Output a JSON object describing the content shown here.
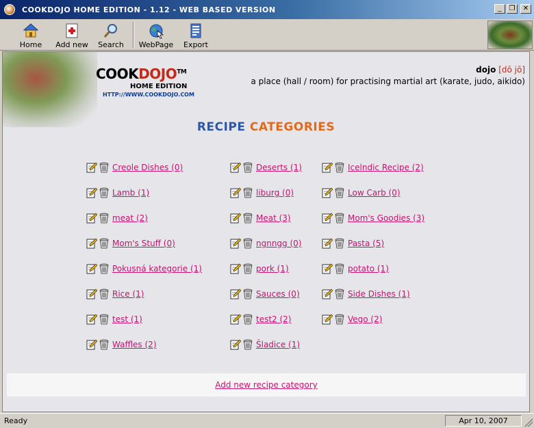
{
  "window": {
    "title": "COOKDOJO HOME EDITION - 1.12 - WEB BASED VERSION",
    "buttons": {
      "minimize": "_",
      "restore": "❐",
      "close": "✕"
    }
  },
  "toolbar": {
    "home": "Home",
    "add_new": "Add new",
    "search": "Search",
    "webpage": "WebPage",
    "export": "Export"
  },
  "header": {
    "brand_cook": "COOK",
    "brand_dojo": "DOJO",
    "brand_tm": "TM",
    "edition": "HOME EDITION",
    "url": "HTTP://WWW.COOKDOJO.COM",
    "definition_word": "dojo",
    "definition_pron": "[dō jō]",
    "definition_text": "a place (hall / room) for practising martial art (karate, judo, aikido)"
  },
  "section": {
    "title_1": "RECIPE",
    "title_2": "CATEGORIES"
  },
  "categories": [
    {
      "label": "Creole Dishes (0)"
    },
    {
      "label": "Lamb (1)"
    },
    {
      "label": "meat (2)"
    },
    {
      "label": "Mom's Stuff (0)"
    },
    {
      "label": "Pokusná kategorie (1)"
    },
    {
      "label": "Rice (1)"
    },
    {
      "label": "test (1)"
    },
    {
      "label": "Waffles (2)"
    },
    {
      "label": "Deserts (1)"
    },
    {
      "label": "liburg (0)"
    },
    {
      "label": "Meat (3)"
    },
    {
      "label": "ngnngg (0)"
    },
    {
      "label": "pork (1)"
    },
    {
      "label": "Sauces (0)"
    },
    {
      "label": "test2 (2)"
    },
    {
      "label": "Šladice (1)"
    },
    {
      "label": "Icelndic Recipe (2)"
    },
    {
      "label": "Low Carb (0)"
    },
    {
      "label": "Mom's Goodies (3)"
    },
    {
      "label": "Pasta (5)"
    },
    {
      "label": "potato (1)"
    },
    {
      "label": "Side Dishes (1)"
    },
    {
      "label": "Vego (2)"
    }
  ],
  "add_category": "Add new recipe category",
  "status": {
    "text": "Ready",
    "date": "Apr 10, 2007"
  },
  "colors": {
    "link": "#c4146e",
    "title_blue": "#2e56a8",
    "title_orange": "#e26a1e",
    "brand_red": "#c42a1a"
  }
}
